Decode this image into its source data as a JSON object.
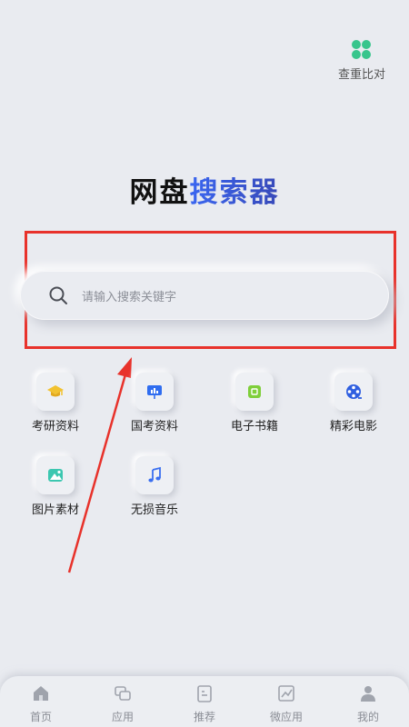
{
  "header": {
    "compare_label": "查重比对"
  },
  "title": {
    "part1": "网盘",
    "part2": "搜索器"
  },
  "search": {
    "placeholder": "请输入搜索关键字"
  },
  "categories": [
    {
      "label": "考研资料",
      "icon": "graduation-cap-icon",
      "color": "#f2c230"
    },
    {
      "label": "国考资料",
      "icon": "chart-board-icon",
      "color": "#2f6df0"
    },
    {
      "label": "电子书籍",
      "icon": "ebook-icon",
      "color": "#7fcf3a"
    },
    {
      "label": "精彩电影",
      "icon": "film-reel-icon",
      "color": "#2f5fe0"
    },
    {
      "label": "图片素材",
      "icon": "image-landscape-icon",
      "color": "#3cc7b0"
    },
    {
      "label": "无损音乐",
      "icon": "music-note-icon",
      "color": "#3a6ff0"
    }
  ],
  "tabbar": [
    {
      "label": "首页",
      "icon": "home-icon"
    },
    {
      "label": "应用",
      "icon": "apps-icon"
    },
    {
      "label": "推荐",
      "icon": "recommend-icon"
    },
    {
      "label": "微应用",
      "icon": "trend-chart-icon"
    },
    {
      "label": "我的",
      "icon": "user-icon"
    }
  ],
  "colors": {
    "annotation_red": "#e8322b",
    "title_blue": "#3a66f0",
    "accent_green": "#38c58c"
  }
}
